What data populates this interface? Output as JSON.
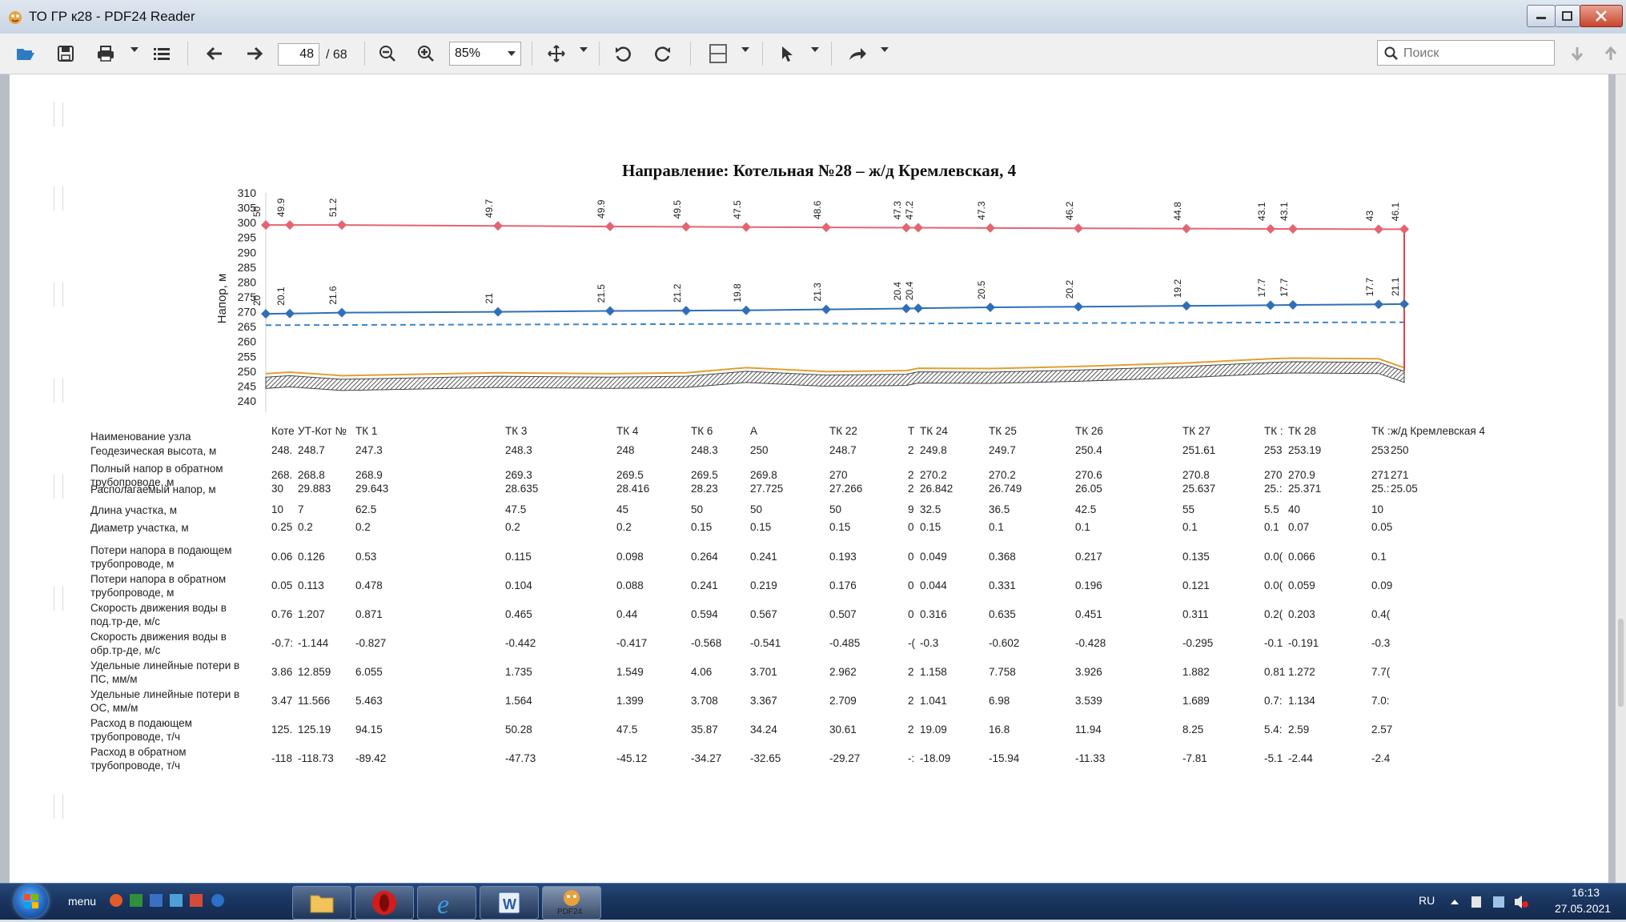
{
  "window": {
    "title": "ТО ГР к28 - PDF24 Reader"
  },
  "toolbar": {
    "page_current": "48",
    "page_total": "/ 68",
    "zoom": "85%",
    "search_placeholder": "Поиск"
  },
  "document": {
    "chart_data": {
      "type": "line",
      "title": "Направление: Котельная №28 – ж/д Кремлевская, 4",
      "ylabel": "Напор, м",
      "ylim": [
        240,
        310
      ],
      "yticks": [
        310,
        305,
        300,
        295,
        290,
        285,
        280,
        275,
        270,
        265,
        260,
        255,
        250,
        245,
        240
      ],
      "x": [
        0,
        30,
        95,
        290,
        430,
        525,
        600,
        700,
        800,
        815,
        905,
        1015,
        1150,
        1255,
        1283,
        1390,
        1422
      ],
      "series": [
        {
          "values": [
            299.2,
            299.2,
            299.2,
            298.9,
            298.7,
            298.6,
            298.5,
            298.4,
            298.3,
            298.3,
            298.2,
            298.1,
            298.0,
            297.9,
            297.9,
            297.8,
            297.8
          ],
          "labels": [
            "50",
            "49.9",
            "51.2",
            "49.7",
            "49.9",
            "49.5",
            "47.5",
            "48.6",
            "47.3",
            "47.2",
            "47.3",
            "46.2",
            "44.8",
            "43.1",
            "43.1",
            "43",
            "46.1"
          ],
          "color": "#e46472"
        },
        {
          "values": [
            269.3,
            269.4,
            269.7,
            270.0,
            270.3,
            270.4,
            270.5,
            270.8,
            271.1,
            271.2,
            271.5,
            271.7,
            272.0,
            272.2,
            272.3,
            272.5,
            272.6
          ],
          "labels": [
            "20",
            "20.1",
            "21.6",
            "21",
            "21.5",
            "21.2",
            "19.8",
            "21.3",
            "20.4",
            "20.4",
            "20.5",
            "20.2",
            "19.2",
            "17.7",
            "17.7",
            "17.7",
            "21.1"
          ],
          "color": "#2f6fb8"
        }
      ]
    },
    "table": {
      "headers": [
        {
          "x": 327,
          "text": "Коте"
        },
        {
          "x": 360,
          "text": "УТ-Кот №"
        },
        {
          "x": 432,
          "text": "ТК 1"
        },
        {
          "x": 619,
          "text": "ТК 3"
        },
        {
          "x": 758,
          "text": "ТК 4"
        },
        {
          "x": 851,
          "text": "ТК 6"
        },
        {
          "x": 925,
          "text": "А"
        },
        {
          "x": 1024,
          "text": "ТК 22"
        },
        {
          "x": 1122,
          "text": "Т"
        },
        {
          "x": 1137,
          "text": "ТК 24"
        },
        {
          "x": 1223,
          "text": "ТК 25"
        },
        {
          "x": 1331,
          "text": "ТК 26"
        },
        {
          "x": 1465,
          "text": "ТК 27"
        },
        {
          "x": 1567,
          "text": "ТК :"
        },
        {
          "x": 1597,
          "text": "ТК 28"
        },
        {
          "x": 1701,
          "text": "ТК :"
        },
        {
          "x": 1725,
          "text": "ж/д Кремлевская 4"
        }
      ],
      "header_label": "Наименование узла",
      "rows": [
        {
          "label": "Геодезическая высота, м",
          "values": [
            "248.",
            "248.7",
            "247.3",
            "248.3",
            "248",
            "248.3",
            "250",
            "248.7",
            "2",
            "249.8",
            "249.7",
            "250.4",
            "251.61",
            "253",
            "253.19",
            "253",
            "250"
          ]
        },
        {
          "label": "Полный напор в обратном трубопроводе, м",
          "values": [
            "268.",
            "268.8",
            "268.9",
            "269.3",
            "269.5",
            "269.5",
            "269.8",
            "270",
            "2",
            "270.2",
            "270.2",
            "270.6",
            "270.8",
            "270",
            "270.9",
            "271",
            "271"
          ]
        },
        {
          "label": "Располагаемый напор, м",
          "values": [
            "30",
            "29.883",
            "29.643",
            "28.635",
            "28.416",
            "28.23",
            "27.725",
            "27.266",
            "2",
            "26.842",
            "26.749",
            "26.05",
            "25.637",
            "25.:",
            "25.371",
            "25.:",
            "25.05"
          ]
        },
        {
          "label": "Длина участка, м",
          "values": [
            "10",
            "7",
            "62.5",
            "47.5",
            "45",
            "50",
            "50",
            "50",
            "9",
            "32.5",
            "36.5",
            "42.5",
            "55",
            "5.5",
            "40",
            "10",
            ""
          ]
        },
        {
          "label": "Диаметр участка, м",
          "values": [
            "0.25",
            "0.2",
            "0.2",
            "0.2",
            "0.2",
            "0.15",
            "0.15",
            "0.15",
            "0",
            "0.15",
            "0.1",
            "0.1",
            "0.1",
            "0.1",
            "0.07",
            "0.05",
            ""
          ]
        },
        {
          "label": "Потери напора в подающем трубопроводе, м",
          "values": [
            "0.06",
            "0.126",
            "0.53",
            "0.115",
            "0.098",
            "0.264",
            "0.241",
            "0.193",
            "0",
            "0.049",
            "0.368",
            "0.217",
            "0.135",
            "0.0(",
            "0.066",
            "0.1",
            ""
          ]
        },
        {
          "label": "Потери напора в обратном трубопроводе, м",
          "values": [
            "0.05",
            "0.113",
            "0.478",
            "0.104",
            "0.088",
            "0.241",
            "0.219",
            "0.176",
            "0",
            "0.044",
            "0.331",
            "0.196",
            "0.121",
            "0.0(",
            "0.059",
            "0.09",
            ""
          ]
        },
        {
          "label": "Скорость движения воды в под.тр-де, м/с",
          "values": [
            "0.76",
            "1.207",
            "0.871",
            "0.465",
            "0.44",
            "0.594",
            "0.567",
            "0.507",
            "0",
            "0.316",
            "0.635",
            "0.451",
            "0.311",
            "0.2(",
            "0.203",
            "0.4(",
            ""
          ]
        },
        {
          "label": "Скорость движения воды в обр.тр-де, м/с",
          "values": [
            "-0.7:",
            "-1.144",
            "-0.827",
            "-0.442",
            "-0.417",
            "-0.568",
            "-0.541",
            "-0.485",
            "-(",
            "-0.3",
            "-0.602",
            "-0.428",
            "-0.295",
            "-0.1",
            "-0.191",
            "-0.3",
            ""
          ]
        },
        {
          "label": "Удельные линейные потери в ПС, мм/м",
          "values": [
            "3.86",
            "12.859",
            "6.055",
            "1.735",
            "1.549",
            "4.06",
            "3.701",
            "2.962",
            "2",
            "1.158",
            "7.758",
            "3.926",
            "1.882",
            "0.81",
            "1.272",
            "7.7(",
            ""
          ]
        },
        {
          "label": "Удельные линейные потери в ОС, мм/м",
          "values": [
            "3.47",
            "11.566",
            "5.463",
            "1.564",
            "1.399",
            "3.708",
            "3.367",
            "2.709",
            "2",
            "1.041",
            "6.98",
            "3.539",
            "1.689",
            "0.7:",
            "1.134",
            "7.0:",
            ""
          ]
        },
        {
          "label": "Расход в подающем трубопроводе, т/ч",
          "values": [
            "125.",
            "125.19",
            "94.15",
            "50.28",
            "47.5",
            "35.87",
            "34.24",
            "30.61",
            "2",
            "19.09",
            "16.8",
            "11.94",
            "8.25",
            "5.4:",
            "2.59",
            "2.57",
            ""
          ]
        },
        {
          "label": "Расход в обратном трубопроводе, т/ч",
          "values": [
            "-118",
            "-118.73",
            "-89.42",
            "-47.73",
            "-45.12",
            "-34.27",
            "-32.65",
            "-29.27",
            "-:",
            "-18.09",
            "-15.94",
            "-11.33",
            "-7.81",
            "-5.1",
            "-2.44",
            "-2.4",
            ""
          ]
        }
      ]
    }
  },
  "taskbar": {
    "menu_label": "menu",
    "lang": "RU",
    "time": "16:13",
    "date": "27.05.2021",
    "pdf24_label": "PDF24"
  },
  "colors": {
    "supply_line": "#e46472",
    "return_line": "#2f6fb8",
    "ground": "#e0a030",
    "static_dash": "#3a86c8"
  }
}
